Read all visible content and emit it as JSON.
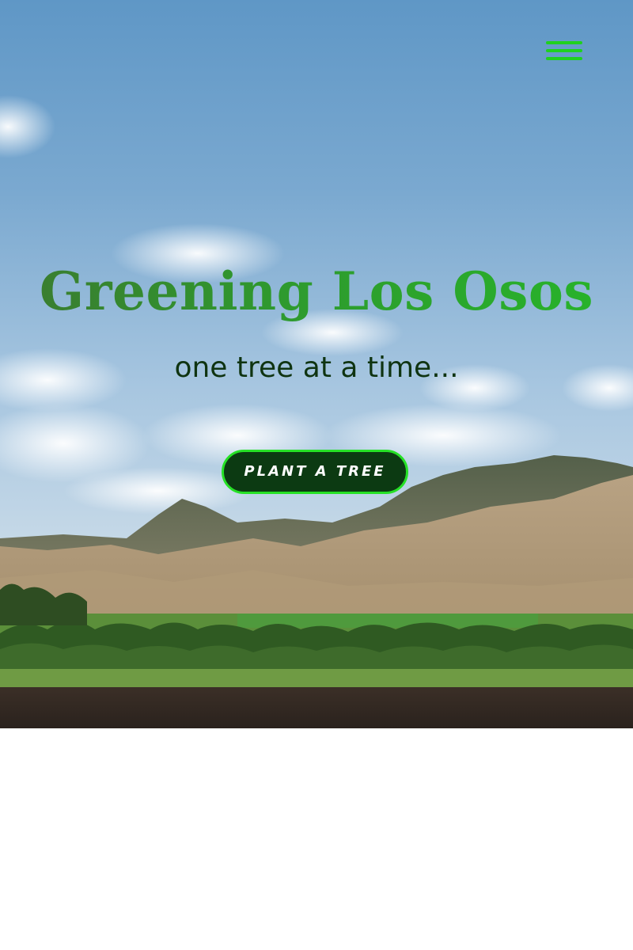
{
  "hero": {
    "title": "Greening Los Osos",
    "subtitle": "one tree at a time...",
    "cta_label": "PLANT A TREE",
    "menu_icon": "hamburger-menu-icon",
    "image_description_icon": "landscape-photo"
  },
  "colors": {
    "accent_green": "#1fd11f",
    "button_bg": "#0c3a12",
    "title_green": "#2e9a2e",
    "subtitle_dark": "#0f3411"
  }
}
